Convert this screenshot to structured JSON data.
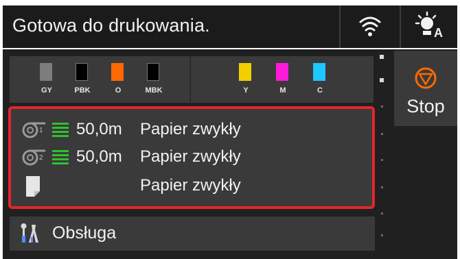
{
  "status": {
    "text": "Gotowa do drukowania."
  },
  "icons": {
    "wifi": "wifi-icon",
    "panel": "panel-brightness-icon",
    "roll": "paper-roll-icon",
    "sheet": "cut-sheet-icon",
    "stop": "stop-icon",
    "maintenance": "maintenance-tools-icon"
  },
  "inks": [
    {
      "label": "GY",
      "color": "#7d7d7d"
    },
    {
      "label": "PBK",
      "color": "#000000"
    },
    {
      "label": "O",
      "color": "#ff6a00"
    },
    {
      "label": "MBK",
      "color": "#000000"
    },
    {
      "label": "Y",
      "color": "#f2d000"
    },
    {
      "label": "M",
      "color": "#ff1ad9"
    },
    {
      "label": "C",
      "color": "#1cc8ff"
    }
  ],
  "paper": [
    {
      "roll_number": "1",
      "length": "50,0m",
      "type": "Papier zwykły"
    },
    {
      "roll_number": "2",
      "length": "50,0m",
      "type": "Papier zwykły"
    },
    {
      "length": "",
      "type": "Papier zwykły"
    }
  ],
  "stop": {
    "label": "Stop"
  },
  "maintenance": {
    "label": "Obsługa"
  },
  "colors": {
    "highlight": "#e3262a",
    "remaining_bar": "#2fc12f",
    "stop_icon": "#ff6a00"
  }
}
